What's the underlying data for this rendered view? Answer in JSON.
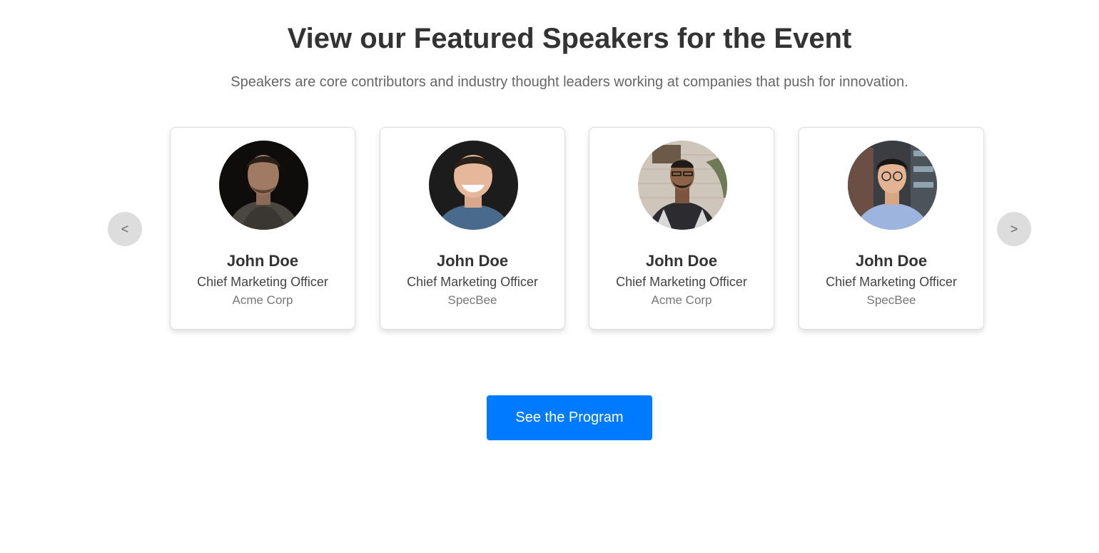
{
  "header": {
    "title": "View our Featured Speakers for the Event",
    "subtitle": "Speakers are core contributors and industry thought leaders working at companies that push for innovation."
  },
  "carousel": {
    "prev_label": "<",
    "next_label": ">",
    "speakers": [
      {
        "name": "John Doe",
        "role": "Chief Marketing Officer",
        "company": "Acme Corp",
        "photo": "speaker-photo-dark-knit-sweater"
      },
      {
        "name": "John Doe",
        "role": "Chief Marketing Officer",
        "company": "SpecBee",
        "photo": "speaker-photo-smiling-dark-background"
      },
      {
        "name": "John Doe",
        "role": "Chief Marketing Officer",
        "company": "Acme Corp",
        "photo": "speaker-photo-plaid-shirt-brick-wall"
      },
      {
        "name": "John Doe",
        "role": "Chief Marketing Officer",
        "company": "SpecBee",
        "photo": "speaker-photo-glasses-bookshelf"
      }
    ]
  },
  "cta": {
    "label": "See the Program"
  },
  "colors": {
    "accent": "#007bff",
    "title_text": "#333333",
    "subtitle_text": "#666666",
    "nav_button_bg": "#dddddd"
  }
}
